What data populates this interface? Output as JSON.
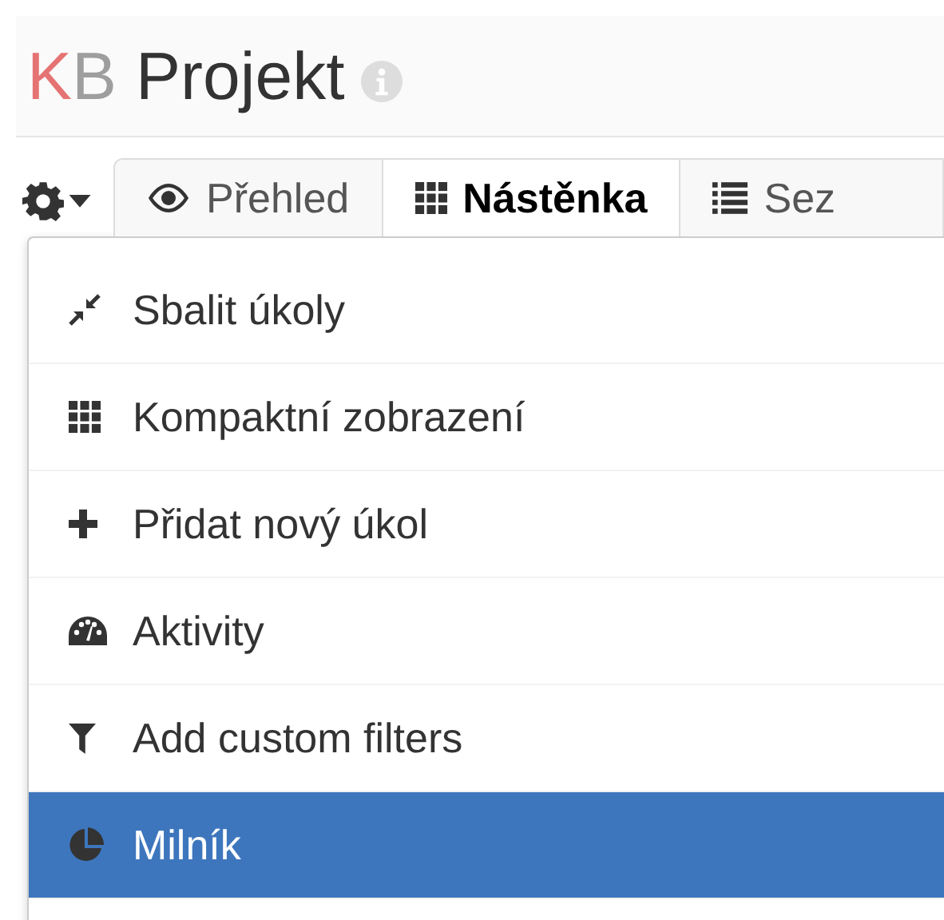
{
  "header": {
    "title_initials": [
      {
        "text": "K",
        "color": "#e57373"
      },
      {
        "text": "B",
        "color": "#9e9e9e"
      }
    ],
    "title": "Projekt"
  },
  "tabs": [
    {
      "label": "Přehled",
      "kind": "eye",
      "selected": false
    },
    {
      "label": "Nástěnka",
      "kind": "grid",
      "selected": true
    },
    {
      "label": "Sez",
      "kind": "list",
      "selected": false
    }
  ],
  "menu": {
    "expanded": true,
    "items": [
      {
        "label": "Sbalit úkoly",
        "kind": "compress",
        "selected": false
      },
      {
        "label": "Kompaktní zobrazení",
        "kind": "grid",
        "selected": false
      },
      {
        "label": "Přidat nový úkol",
        "kind": "plus",
        "selected": false
      },
      {
        "label": "Aktivity",
        "kind": "dashboard",
        "selected": false
      },
      {
        "label": "Add custom filters",
        "kind": "filter",
        "selected": false
      },
      {
        "label": "Milník",
        "kind": "pie",
        "selected": true
      }
    ]
  }
}
